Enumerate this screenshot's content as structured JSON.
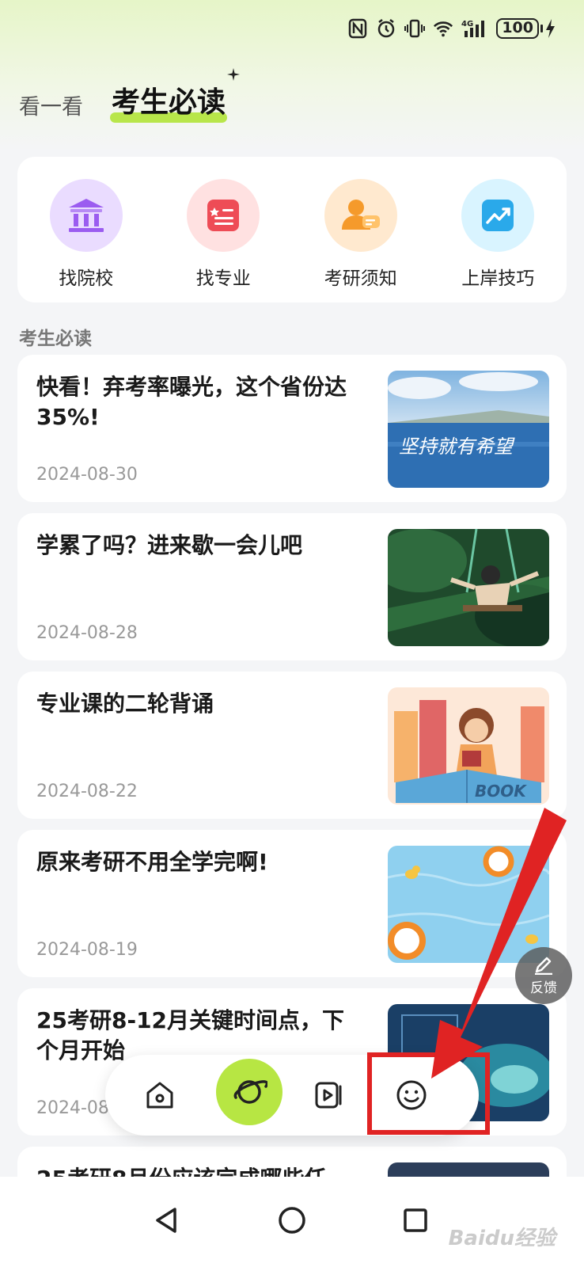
{
  "status_bar": {
    "icons": [
      "nfc-icon",
      "alarm-icon",
      "vibrate-icon",
      "wifi-icon",
      "signal-4g-icon"
    ],
    "network": "4G",
    "battery": "100"
  },
  "tabs": {
    "inactive": "看一看",
    "active": "考生必读"
  },
  "categories": [
    {
      "label": "找院校",
      "icon": "university-icon",
      "bg": "#eadcff",
      "color": "#9b5cf0"
    },
    {
      "label": "找专业",
      "icon": "list-document-icon",
      "bg": "#ffe1e1",
      "color": "#ee4c56"
    },
    {
      "label": "考研须知",
      "icon": "user-chat-icon",
      "bg": "#ffe9cf",
      "color": "#f59a2b"
    },
    {
      "label": "上岸技巧",
      "icon": "trend-chart-icon",
      "bg": "#d9f4ff",
      "color": "#2aa9ea"
    }
  ],
  "section_title": "考生必读",
  "articles": [
    {
      "title": "快看！弃考率曝光，这个省份达35%!",
      "date": "2024-08-30",
      "thumb_text": "坚持就有希望"
    },
    {
      "title": "学累了吗？进来歇一会儿吧",
      "date": "2024-08-28"
    },
    {
      "title": "专业课的二轮背诵",
      "date": "2024-08-22",
      "thumb_text": "BOOK"
    },
    {
      "title": "原来考研不用全学完啊!",
      "date": "2024-08-19"
    },
    {
      "title": "25考研8-12月关键时间点，下个月开始",
      "date": "2024-08-"
    },
    {
      "title": "25考研8月份应该完成哪些任",
      "date": ""
    }
  ],
  "feedback": {
    "label": "反馈"
  },
  "bottom_nav": {
    "items": [
      "home-icon",
      "planet-icon",
      "video-icon",
      "smiley-icon"
    ],
    "accent": "#b7e643"
  },
  "watermark": "Baidu经验",
  "annotation_color": "#e02323"
}
